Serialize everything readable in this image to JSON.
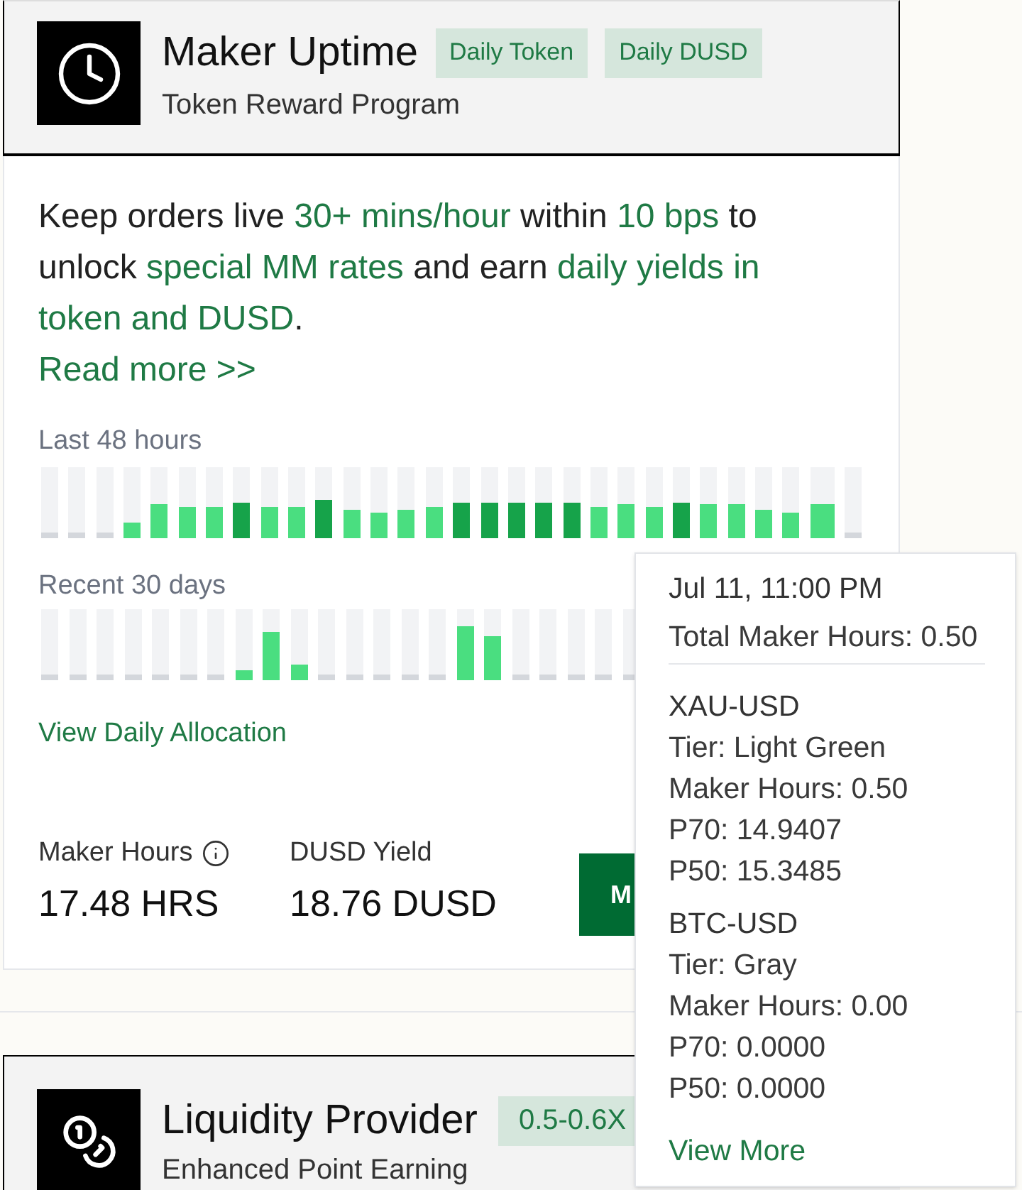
{
  "program": {
    "title": "Maker Uptime",
    "subtitle": "Token Reward Program",
    "badges": [
      "Daily Token",
      "Daily DUSD"
    ]
  },
  "description": [
    {
      "text": "Keep orders live ",
      "highlight": false
    },
    {
      "text": "30+ mins/hour",
      "highlight": true
    },
    {
      "text": " within ",
      "highlight": false
    },
    {
      "text": "10 bps",
      "highlight": true
    },
    {
      "text": " to unlock ",
      "highlight": false
    },
    {
      "text": "special MM rates",
      "highlight": true
    },
    {
      "text": " and earn ",
      "highlight": false
    },
    {
      "text": "daily yields in token and DUSD",
      "highlight": true
    },
    {
      "text": ".",
      "highlight": false
    }
  ],
  "read_more": "Read more >>",
  "hourly_uptime": {
    "label": "Last 48 hours"
  },
  "daily_uptime": {
    "label": "Recent 30 days"
  },
  "allocation_link": "View Daily Allocation",
  "stats": [
    {
      "label": "Maker Hours",
      "value": "17.48 HRS",
      "info": true
    },
    {
      "label": "DUSD Yield",
      "value": "18.76 DUSD",
      "info": false
    }
  ],
  "action_button": "M",
  "next_program": {
    "title": "Liquidity Provider",
    "subtitle": "Enhanced Point Earning",
    "badges": [
      "0.5-0.6X"
    ]
  },
  "tooltip": {
    "time": "Jul 11, 11:00 PM",
    "total": "Total Maker Hours: 0.50",
    "markets": [
      {
        "symbol": "XAU-USD",
        "lines": [
          "Tier: Light Green",
          "Maker Hours: 0.50",
          "P70: 14.9407",
          "P50: 15.3485"
        ]
      },
      {
        "symbol": "BTC-USD",
        "lines": [
          "Tier: Gray",
          "Maker Hours: 0.00",
          "P70: 0.0000",
          "P50: 0.0000"
        ]
      }
    ],
    "link": "View More"
  }
}
